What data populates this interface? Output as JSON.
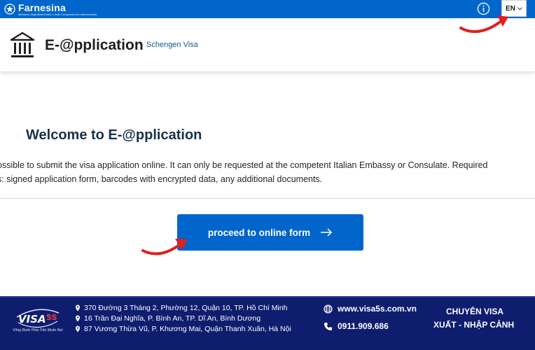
{
  "topbar": {
    "logo_name": "Farnesina",
    "logo_sub": "Ministero degli Affari Esteri e della Cooperazione Internazionale",
    "lang": "EN"
  },
  "header": {
    "title": "E-@pplication",
    "subtitle": "Schengen Visa"
  },
  "main": {
    "welcome": "Welcome to E-@pplication",
    "line1": "ossible to submit the visa application online. It can only be requested at the competent Italian Embassy or Consulate. Required",
    "line2": "s: signed application form, barcodes with encrypted data, any additional documents.",
    "proceed_label": "proceed to online form"
  },
  "footer": {
    "brand_slogan": "Vững Bước Phía Trên Muôn Nơi",
    "addresses": [
      "370 Đường 3 Tháng 2, Phường 12, Quận 10, TP. Hồ Chí Minh",
      "16 Trần Đại Nghĩa, P. Bình An, TP. Dĩ An, Bình Dương",
      "87 Vương Thừa Vũ, P. Khương Mai, Quận Thanh Xuân, Hà Nội"
    ],
    "website": "www.visa5s.com.vn",
    "phone": "0911.909.686",
    "slogan_line1": "CHUYÊN VISA",
    "slogan_line2": "XUẤT - NHẬP CẢNH"
  },
  "colors": {
    "primary_blue": "#0066cc",
    "footer_navy": "#0f1d6e",
    "annotation_red": "#e0201b"
  }
}
